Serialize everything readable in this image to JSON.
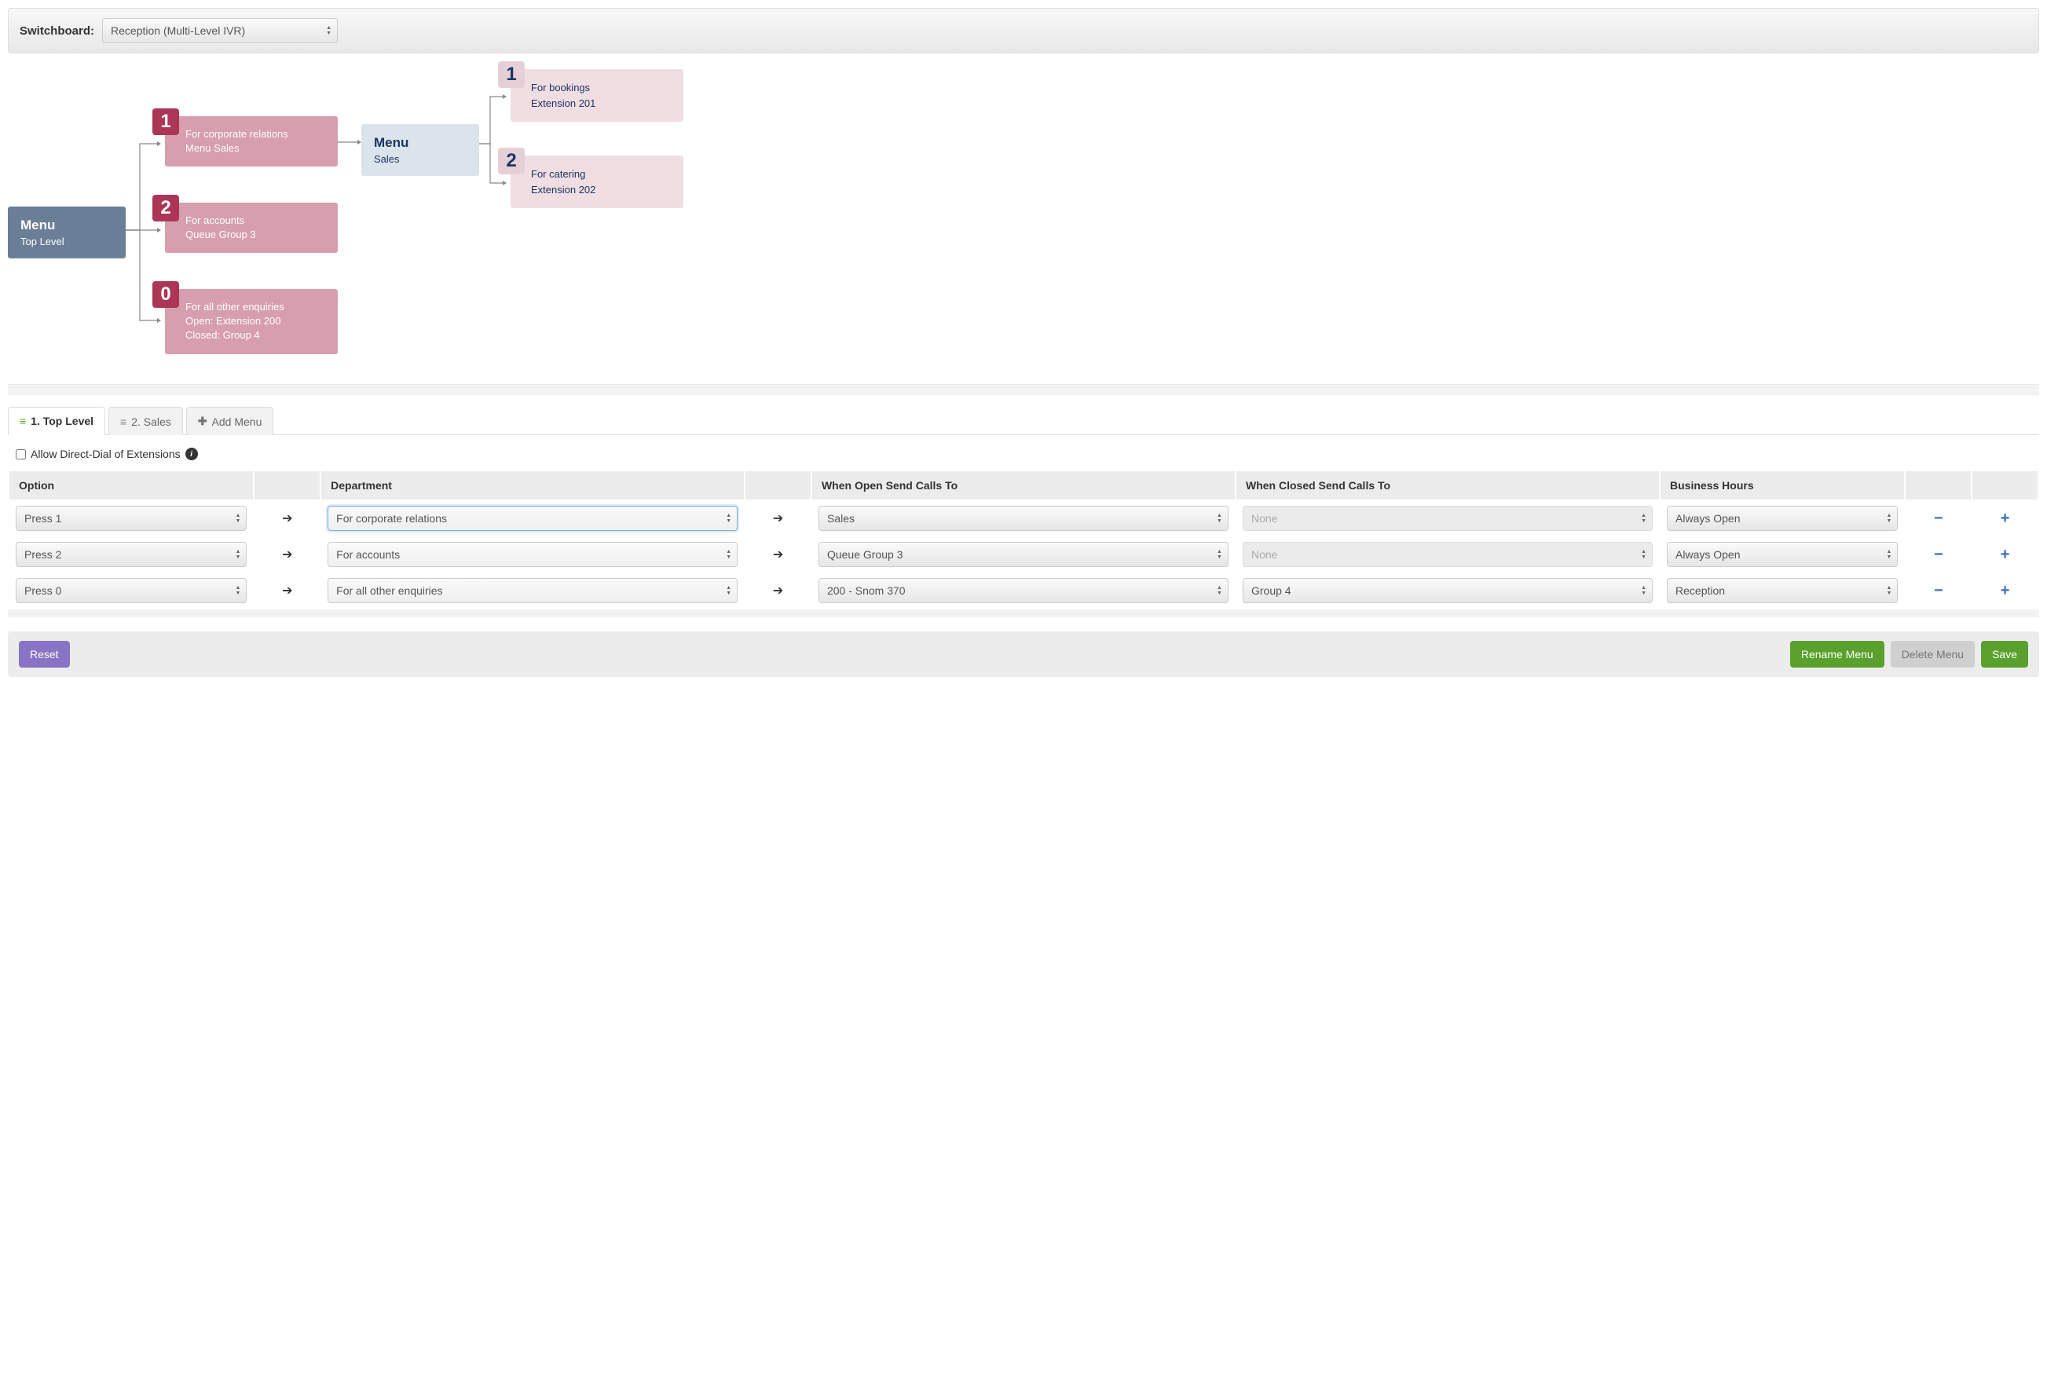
{
  "switchboard": {
    "label": "Switchboard:",
    "selected": "Reception (Multi-Level IVR)"
  },
  "diagram": {
    "root": {
      "title": "Menu",
      "sub": "Top Level"
    },
    "opts": [
      {
        "digit": "1",
        "line1": "For corporate relations",
        "line2": "Menu Sales"
      },
      {
        "digit": "2",
        "line1": "For accounts",
        "line2": "Queue Group 3"
      },
      {
        "digit": "0",
        "line1": "For all other enquiries",
        "line2": "Open: Extension 200",
        "line3": "Closed: Group 4"
      }
    ],
    "sales": {
      "title": "Menu",
      "sub": "Sales"
    },
    "subs": [
      {
        "digit": "1",
        "line1": "For bookings",
        "line2": "Extension 201"
      },
      {
        "digit": "2",
        "line1": "For catering",
        "line2": "Extension 202"
      }
    ]
  },
  "tabs": {
    "tab1": "1. Top Level",
    "tab2": "2. Sales",
    "add": "Add Menu"
  },
  "allow": {
    "label": "Allow Direct-Dial of Extensions"
  },
  "headers": {
    "option": "Option",
    "department": "Department",
    "open": "When Open Send Calls To",
    "closed": "When Closed Send Calls To",
    "hours": "Business Hours"
  },
  "rows": [
    {
      "option": "Press 1",
      "dept": "For corporate relations",
      "open": "Sales",
      "closed": "None",
      "hours": "Always Open",
      "closed_disabled": true,
      "focused": true
    },
    {
      "option": "Press 2",
      "dept": "For accounts",
      "open": "Queue Group 3",
      "closed": "None",
      "hours": "Always Open",
      "closed_disabled": true
    },
    {
      "option": "Press 0",
      "dept": "For all other enquiries",
      "open": "200 - Snom 370",
      "closed": "Group 4",
      "hours": "Reception",
      "closed_disabled": false
    }
  ],
  "buttons": {
    "reset": "Reset",
    "rename": "Rename Menu",
    "delete": "Delete Menu",
    "save": "Save"
  }
}
